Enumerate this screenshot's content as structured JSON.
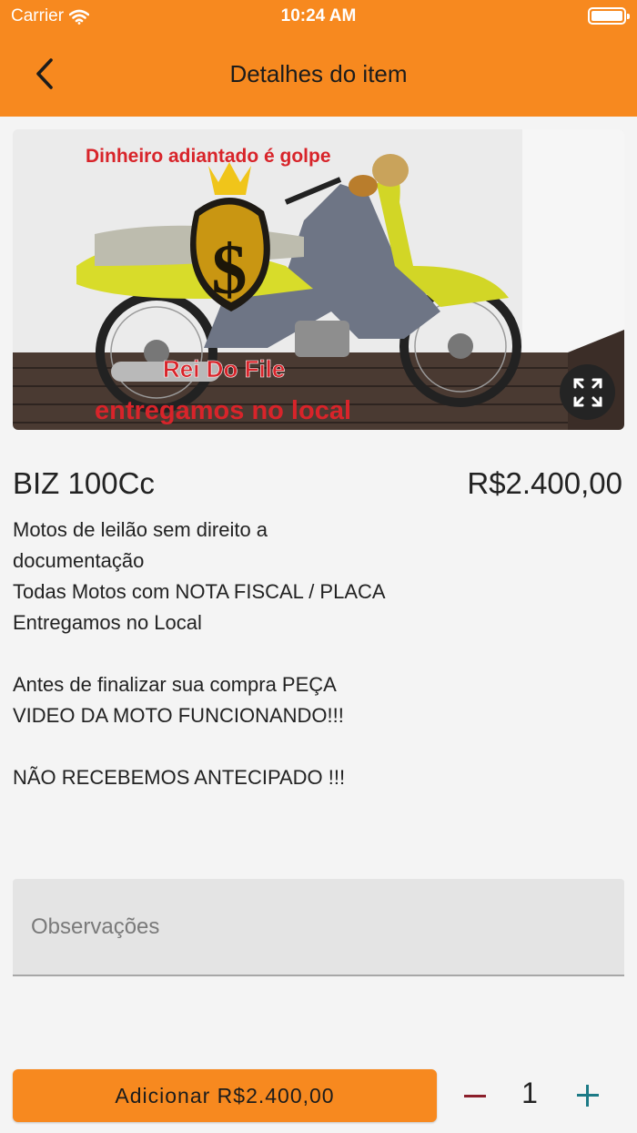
{
  "status_bar": {
    "carrier": "Carrier",
    "time": "10:24 AM"
  },
  "nav": {
    "title": "Detalhes do item",
    "back_icon": "chevron-left-icon",
    "color": "#f7891f"
  },
  "photo": {
    "overlay_top": "Dinheiro adiantado é golpe",
    "overlay_brand": "Rei Do File",
    "overlay_bottom": "entregamos no local",
    "expand_icon": "expand-icon"
  },
  "item": {
    "title": "BIZ 100Cc",
    "price": "R$2.400,00",
    "description": "Motos de leilão sem direito a documentação\nTodas Motos com NOTA FISCAL / PLACA\nEntregamos no Local\n\nAntes de finalizar sua compra PEÇA VIDEO DA MOTO FUNCIONANDO!!!\n\nNÃO RECEBEMOS ANTECIPADO !!!"
  },
  "notes": {
    "placeholder": "Observações",
    "value": ""
  },
  "footer": {
    "add_label": "Adicionar R$2.400,00",
    "quantity": "1",
    "minus_color": "#8b1e2a",
    "plus_color": "#1c7a86"
  }
}
